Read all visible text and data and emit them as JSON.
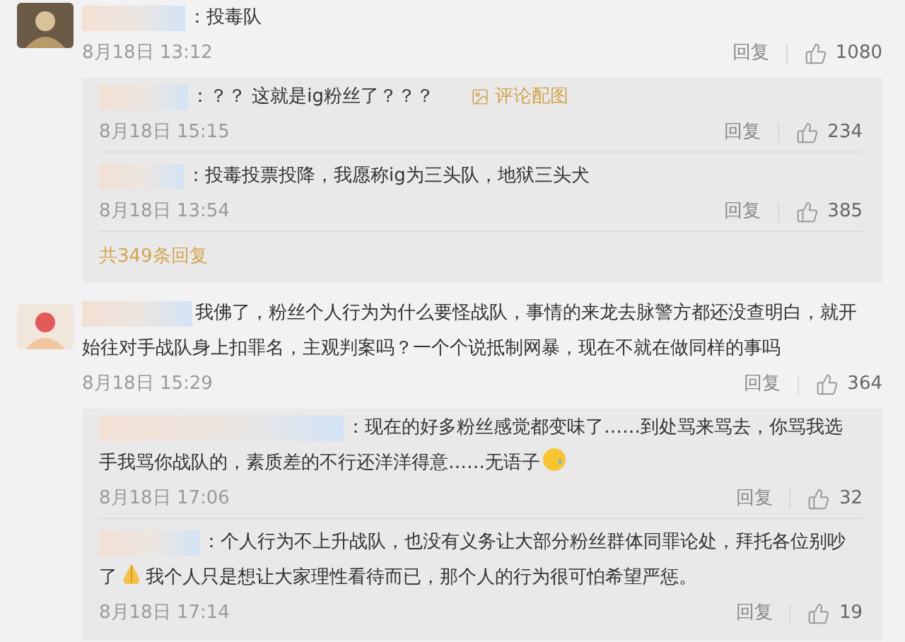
{
  "comments": [
    {
      "parts": [
        {
          "kind": "text",
          "text": "：投毒队"
        }
      ],
      "date": "8月18日 13:12",
      "reply": "回复",
      "likes": "1080",
      "replies": [
        {
          "parts": [
            {
              "kind": "text",
              "text": "：？？ 这就是ig粉丝了？？？"
            }
          ],
          "attachment": "评论配图",
          "date": "8月18日 15:15",
          "reply": "回复",
          "likes": "234"
        },
        {
          "parts": [
            {
              "kind": "text",
              "text": "：投毒投票投降，我愿称ig为三头队，地狱三头犬"
            }
          ],
          "date": "8月18日 13:54",
          "reply": "回复",
          "likes": "385"
        }
      ],
      "more": "共349条回复"
    },
    {
      "parts": [
        {
          "kind": "text",
          "text": "我佛了，粉丝个人行为为什么要怪战队，事情的来龙去脉警方都还没查明白，就开始往对手战队身上扣罪名，主观判案吗？一个个说抵制网暴，现在不就在做同样的事吗"
        }
      ],
      "date": "8月18日 15:29",
      "reply": "回复",
      "likes": "364",
      "replies": [
        {
          "parts": [
            {
              "kind": "text",
              "text": "：现在的好多粉丝感觉都变味了……到处骂来骂去，你骂我选手我骂你战队的，素质差的不行还洋洋得意……无语子"
            },
            {
              "kind": "sweat"
            }
          ],
          "date": "8月18日 17:06",
          "reply": "回复",
          "likes": "32"
        },
        {
          "parts": [
            {
              "kind": "text",
              "text": "：个人行为不上升战队，也没有义务让大部分粉丝群体同罪论处，拜托各位别吵了"
            },
            {
              "kind": "palms"
            },
            {
              "kind": "text",
              "text": "我个人只是想让大家理性看待而已，那个人的行为很可怕希望严惩。"
            }
          ],
          "date": "8月18日 17:14",
          "reply": "回复",
          "likes": "19"
        }
      ]
    }
  ]
}
